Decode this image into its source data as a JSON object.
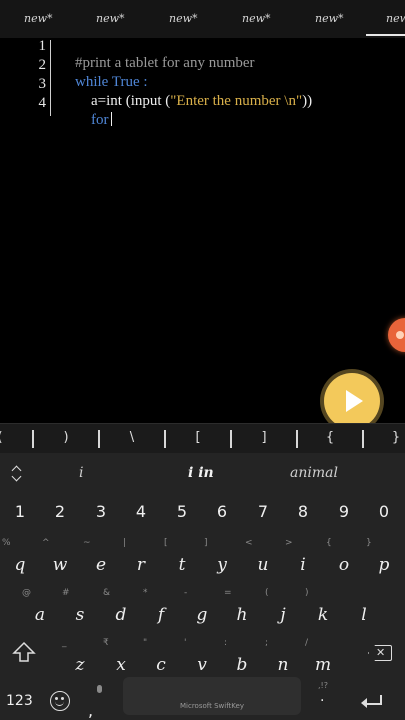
{
  "tabs": [
    "new*",
    "new*",
    "new*",
    "new*",
    "new*",
    "new"
  ],
  "editor": {
    "line_numbers": [
      "1",
      "2",
      "3",
      "4"
    ],
    "lines": {
      "l1_comment": "#print a tablet for any number",
      "l2_keyword": "while",
      "l2_rest": " True :",
      "l3_plain_a": "a=int (input (",
      "l3_string": "\"Enter the number \\n\"",
      "l3_plain_b": "))",
      "l4_keyword": "for"
    }
  },
  "symbol_bar": [
    "(",
    ")",
    "\\",
    "[",
    "]",
    "{",
    "}"
  ],
  "keyboard": {
    "suggestions": [
      "i",
      "i in",
      "animal"
    ],
    "numbers": [
      "1",
      "2",
      "3",
      "4",
      "5",
      "6",
      "7",
      "8",
      "9",
      "0"
    ],
    "row1": [
      {
        "key": "q",
        "hint": "%"
      },
      {
        "key": "w",
        "hint": "^"
      },
      {
        "key": "e",
        "hint": "~"
      },
      {
        "key": "r",
        "hint": "|"
      },
      {
        "key": "t",
        "hint": "["
      },
      {
        "key": "y",
        "hint": "]"
      },
      {
        "key": "u",
        "hint": "<"
      },
      {
        "key": "i",
        "hint": ">"
      },
      {
        "key": "o",
        "hint": "{"
      },
      {
        "key": "p",
        "hint": "}"
      }
    ],
    "row2": [
      {
        "key": "a",
        "hint": "@"
      },
      {
        "key": "s",
        "hint": "#"
      },
      {
        "key": "d",
        "hint": "&"
      },
      {
        "key": "f",
        "hint": "*"
      },
      {
        "key": "g",
        "hint": "-"
      },
      {
        "key": "h",
        "hint": "="
      },
      {
        "key": "j",
        "hint": "("
      },
      {
        "key": "k",
        "hint": ")"
      },
      {
        "key": "l",
        "hint": ""
      }
    ],
    "row3": [
      {
        "key": "z",
        "hint": "_"
      },
      {
        "key": "x",
        "hint": "₹"
      },
      {
        "key": "c",
        "hint": "\""
      },
      {
        "key": "v",
        "hint": "'"
      },
      {
        "key": "b",
        "hint": ":"
      },
      {
        "key": "n",
        "hint": ";"
      },
      {
        "key": "m",
        "hint": "/"
      }
    ],
    "mode_key": "123",
    "comma": ",",
    "spacebar_label": "Microsoft SwiftKey",
    "period": ".",
    "period_hint": ",!?"
  }
}
